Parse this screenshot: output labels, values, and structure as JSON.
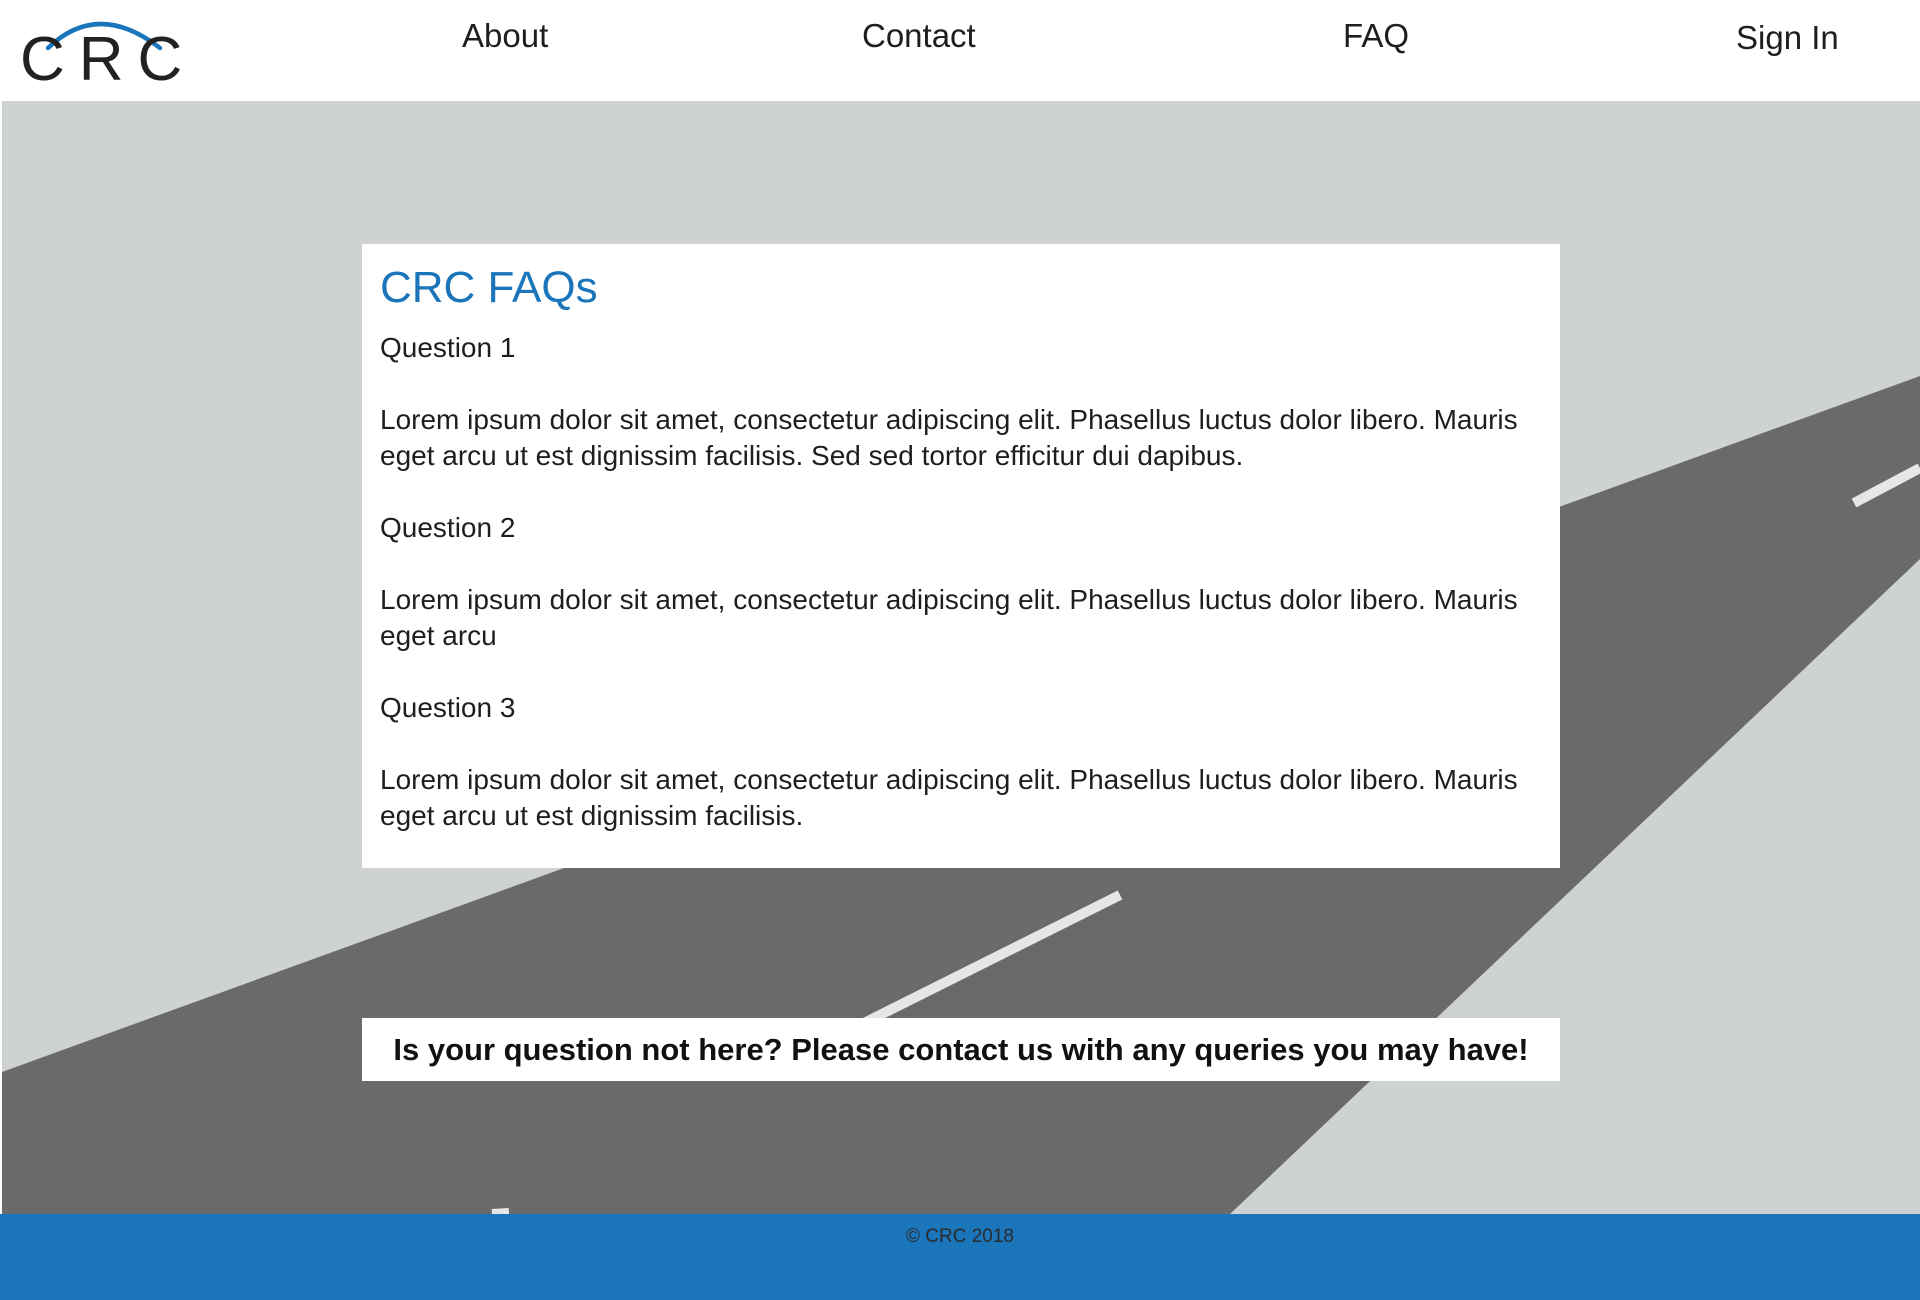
{
  "brand": {
    "logo_text": "CRC",
    "accent_color": "#1b75bb"
  },
  "nav": {
    "about": "About",
    "contact": "Contact",
    "faq": "FAQ",
    "sign_in": "Sign In"
  },
  "faq": {
    "title": "CRC FAQs",
    "items": [
      {
        "question": "Question 1",
        "answer": "Lorem ipsum dolor sit amet, consectetur adipiscing elit. Phasellus luctus dolor libero. Mauris eget arcu ut est dignissim facilisis. Sed sed tortor efficitur dui dapibus."
      },
      {
        "question": "Question 2",
        "answer": "Lorem ipsum dolor sit amet, consectetur adipiscing elit. Phasellus luctus dolor libero. Mauris eget arcu"
      },
      {
        "question": "Question 3",
        "answer": "Lorem ipsum dolor sit amet, consectetur adipiscing elit. Phasellus luctus dolor libero. Mauris eget arcu ut est dignissim facilisis."
      }
    ]
  },
  "contact_banner": {
    "text": "Is your question not here? Please contact us with any queries you may have!"
  },
  "footer": {
    "copyright": "© CRC 2018"
  },
  "colors": {
    "hero_background": "#cfd2d2",
    "road": "#6a6a6a",
    "road_marking": "#e6e6e6",
    "footer_background": "#1b75bb"
  }
}
